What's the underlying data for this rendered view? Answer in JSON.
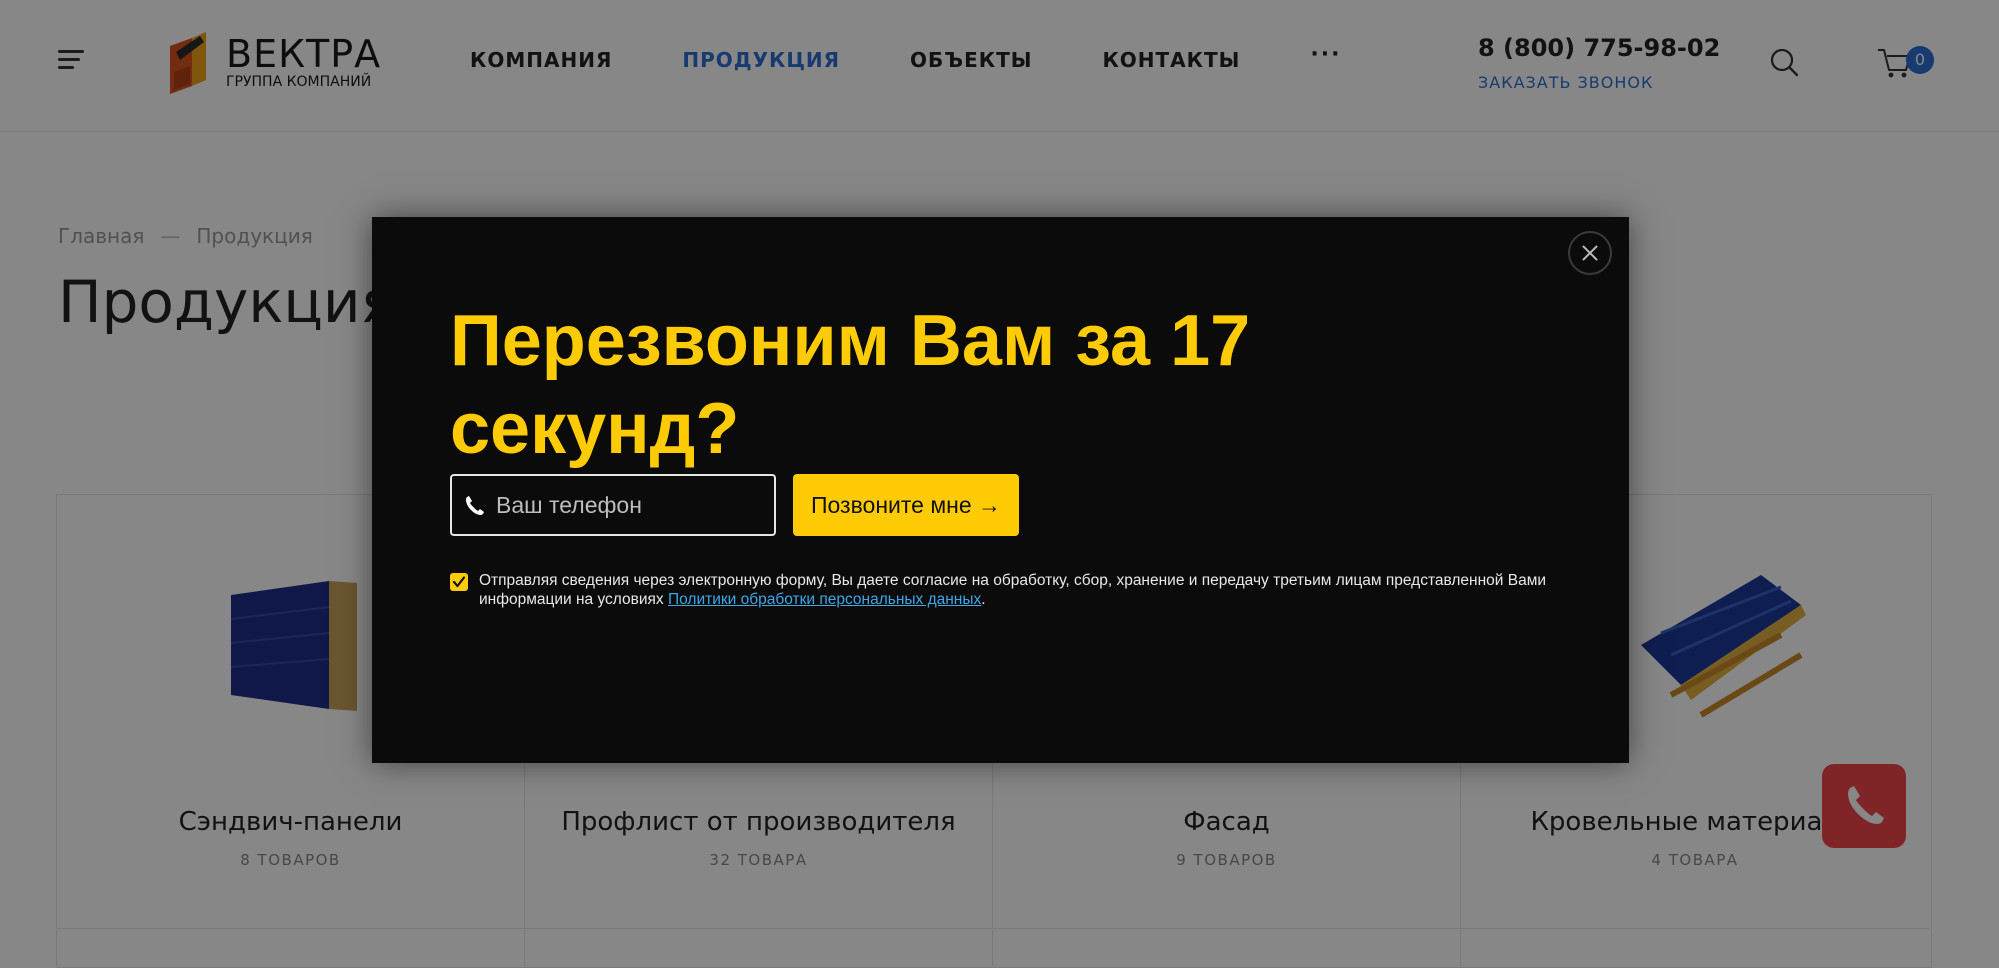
{
  "header": {
    "logo_title": "ВЕКТРА",
    "logo_subtitle": "ГРУППА КОМПАНИЙ",
    "nav": [
      {
        "label": "КОМПАНИЯ"
      },
      {
        "label": "ПРОДУКЦИЯ",
        "active": true
      },
      {
        "label": "ОБЪЕКТЫ"
      },
      {
        "label": "КОНТАКТЫ"
      },
      {
        "label": "···"
      }
    ],
    "phone": "8 (800) 775-98-02",
    "callback_label": "ЗАКАЗАТЬ ЗВОНОК",
    "cart_count": "0"
  },
  "breadcrumb": {
    "home": "Главная",
    "separator": "—",
    "current": "Продукция"
  },
  "page_title": "Продукция",
  "categories": [
    {
      "name": "Сэндвич-панели",
      "count": "8 ТОВАРОВ"
    },
    {
      "name": "Профлист от производителя",
      "count": "32 ТОВАРА"
    },
    {
      "name": "Фасад",
      "count": "9 ТОВАРОВ"
    },
    {
      "name": "Кровельные материалы",
      "count": "4 ТОВАРА"
    }
  ],
  "modal": {
    "title": "Перезвоним Вам за 17 секунд?",
    "phone_placeholder": "Ваш телефон",
    "submit_label": "Позвоните мне →",
    "consent_text": "Отправляя сведения через электронную форму, Вы даете согласие на обработку, сбор, хранение и передачу третьим лицам представленной Вами информации на условиях ",
    "consent_link": "Политики обработки персональных данных",
    "consent_end": ".",
    "consent_checked": true
  },
  "colors": {
    "accent_blue": "#2c6fd1",
    "modal_yellow": "#ffcb05",
    "call_red": "#f0474c"
  }
}
